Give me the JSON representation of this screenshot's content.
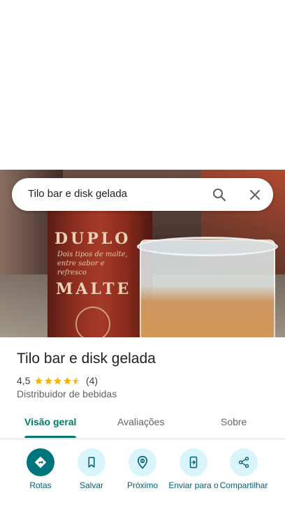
{
  "search": {
    "query": "Tilo bar e disk gelada"
  },
  "photo": {
    "can_text_top": "DUPLO",
    "can_tagline": "Dois tipos de malte, entre sabor e refresco",
    "can_text_bottom": "MALTE"
  },
  "place": {
    "name": "Tilo bar e disk gelada",
    "rating": "4,5",
    "stars": 4.5,
    "review_count": "(4)",
    "category": "Distribuidor de bebidas"
  },
  "tabs": [
    {
      "label": "Visão geral",
      "active": true
    },
    {
      "label": "Avaliações",
      "active": false
    },
    {
      "label": "Sobre",
      "active": false
    }
  ],
  "actions": [
    {
      "label": "Rotas",
      "icon": "directions-icon"
    },
    {
      "label": "Salvar",
      "icon": "bookmark-icon"
    },
    {
      "label": "Próximo",
      "icon": "nearby-icon"
    },
    {
      "label": "Enviar para o",
      "icon": "send-to-phone-icon"
    },
    {
      "label": "Compartilhar",
      "icon": "share-icon"
    }
  ],
  "colors": {
    "accent": "#00796b",
    "action_primary": "#00747d",
    "action_bg": "#d8f5fb",
    "star": "#f4b400"
  }
}
